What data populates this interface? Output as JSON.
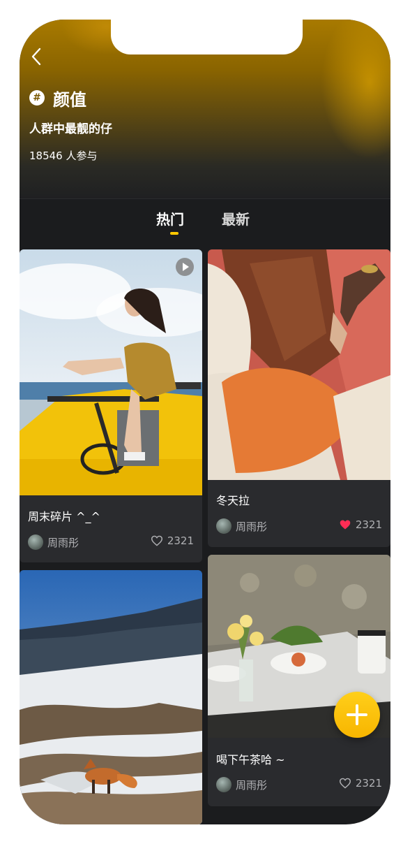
{
  "header": {
    "tag": "颜值",
    "hash_symbol": "#",
    "subtitle": "人群中最靓的仔",
    "participants": "18546 人参与"
  },
  "tabs": [
    {
      "label": "热门",
      "active": true
    },
    {
      "label": "最新",
      "active": false
    }
  ],
  "posts": [
    {
      "title": "周末碎片 ^_^",
      "author": "周雨彤",
      "likes": "2321",
      "liked": false,
      "is_video": true
    },
    {
      "title": "冬天拉",
      "author": "周雨彤",
      "likes": "2321",
      "liked": true,
      "is_video": false
    },
    {
      "title": "",
      "author": "",
      "likes": "",
      "liked": false,
      "is_video": false
    },
    {
      "title": "喝下午茶哈 ~",
      "author": "周雨彤",
      "likes": "2321",
      "liked": false,
      "is_video": false
    }
  ],
  "colors": {
    "accent": "#ffc800",
    "background": "#1b1c1e",
    "card": "#2a2b2e",
    "like_active": "#ff2d55"
  },
  "icons": {
    "back": "chevron-left-icon",
    "hashtag": "hash-icon",
    "play": "play-icon",
    "heart": "heart-icon",
    "add": "plus-icon"
  }
}
